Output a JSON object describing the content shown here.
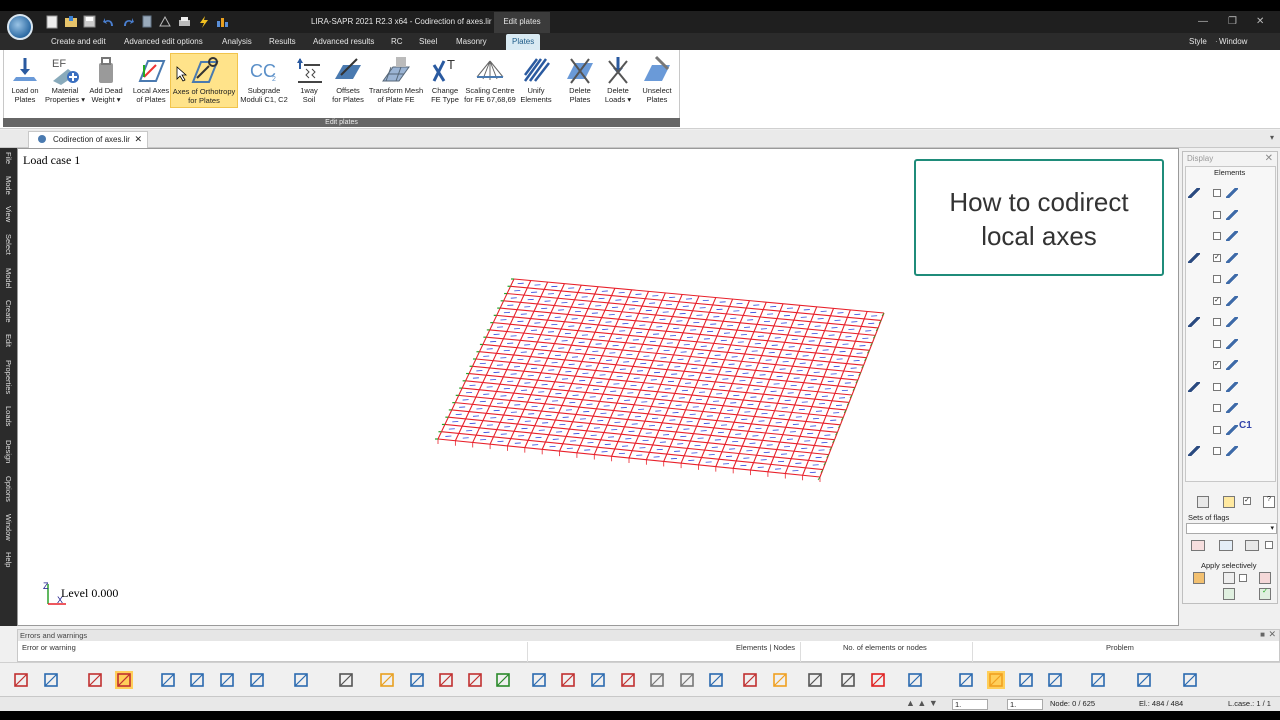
{
  "window": {
    "app_title": "LIRA-SAPR  2021 R2.3 x64 - Codirection of axes.lir",
    "context_tab_title": "Edit plates"
  },
  "menu": {
    "tabs": [
      "Create and edit",
      "Advanced edit options",
      "Analysis",
      "Results",
      "Advanced results",
      "RC",
      "Steel",
      "Masonry",
      "Plates"
    ],
    "active": "Plates",
    "right_items": [
      "Style",
      "Window"
    ]
  },
  "ribbon": {
    "group_label": "Edit plates",
    "buttons": [
      {
        "line1": "Load on",
        "line2": "Plates",
        "icon": "load-on-plates-icon"
      },
      {
        "line1": "Material",
        "line2": "Properties ▾",
        "icon": "material-properties-icon"
      },
      {
        "line1": "Add Dead",
        "line2": "Weight ▾",
        "icon": "add-dead-weight-icon"
      },
      {
        "line1": "Local Axes",
        "line2": "of Plates",
        "icon": "local-axes-icon"
      },
      {
        "line1": "Axes of Orthotropy",
        "line2": "for Plates",
        "icon": "axes-orthotropy-icon"
      },
      {
        "line1": "Subgrade",
        "line2": "Moduli C1, C2",
        "icon": "subgrade-moduli-icon"
      },
      {
        "line1": "1way",
        "line2": "Soil",
        "icon": "one-way-soil-icon"
      },
      {
        "line1": "Offsets",
        "line2": "for Plates",
        "icon": "offsets-icon"
      },
      {
        "line1": "Transform Mesh",
        "line2": "of Plate FE",
        "icon": "transform-mesh-icon"
      },
      {
        "line1": "Change",
        "line2": "FE Type",
        "icon": "change-fe-type-icon"
      },
      {
        "line1": "Scaling Centre",
        "line2": "for FE 67,68,69",
        "icon": "scaling-centre-icon"
      },
      {
        "line1": "Unify",
        "line2": "Elements",
        "icon": "unify-elements-icon"
      },
      {
        "line1": "Delete",
        "line2": "Plates",
        "icon": "delete-plates-icon"
      },
      {
        "line1": "Delete",
        "line2": "Loads ▾",
        "icon": "delete-loads-icon"
      },
      {
        "line1": "Unselect",
        "line2": "Plates",
        "icon": "unselect-plates-icon"
      }
    ],
    "active_button": "Axes of Orthotropy"
  },
  "document": {
    "tab_label": "Codirection of axes.lir",
    "load_case": "Load case 1",
    "level": "Level 0.000",
    "axis_labels": {
      "z": "Z",
      "x": "X"
    }
  },
  "sidebar": {
    "items": [
      "File",
      "Mode",
      "View",
      "Select",
      "Model",
      "Create",
      "Edit",
      "Properties",
      "Loads",
      "Design",
      "Options",
      "Window",
      "Help"
    ]
  },
  "callout": {
    "line1": "How to codirect",
    "line2": "local axes"
  },
  "display_panel": {
    "title": "Display",
    "elements_label": "Elements",
    "sets_of_flags_label": "Sets of flags",
    "apply_selectively_label": "Apply selectively",
    "c1_label": "C1"
  },
  "errors_panel": {
    "title": "Errors and warnings",
    "columns": [
      "Error or warning",
      "Elements | Nodes",
      "No. of elements or nodes",
      "Problem"
    ]
  },
  "status": {
    "field1": "1.",
    "field2": "1.",
    "node": "Node: 0 / 625",
    "el": "El.: 484 / 484",
    "lcase": "L.case.: 1 / 1"
  },
  "colors": {
    "mesh_red": "#e8202a",
    "mesh_blue": "#3344dd",
    "support_green": "#2aa02a",
    "callout_border": "#1f8c7a",
    "active_highlight": "#ffe38a"
  }
}
